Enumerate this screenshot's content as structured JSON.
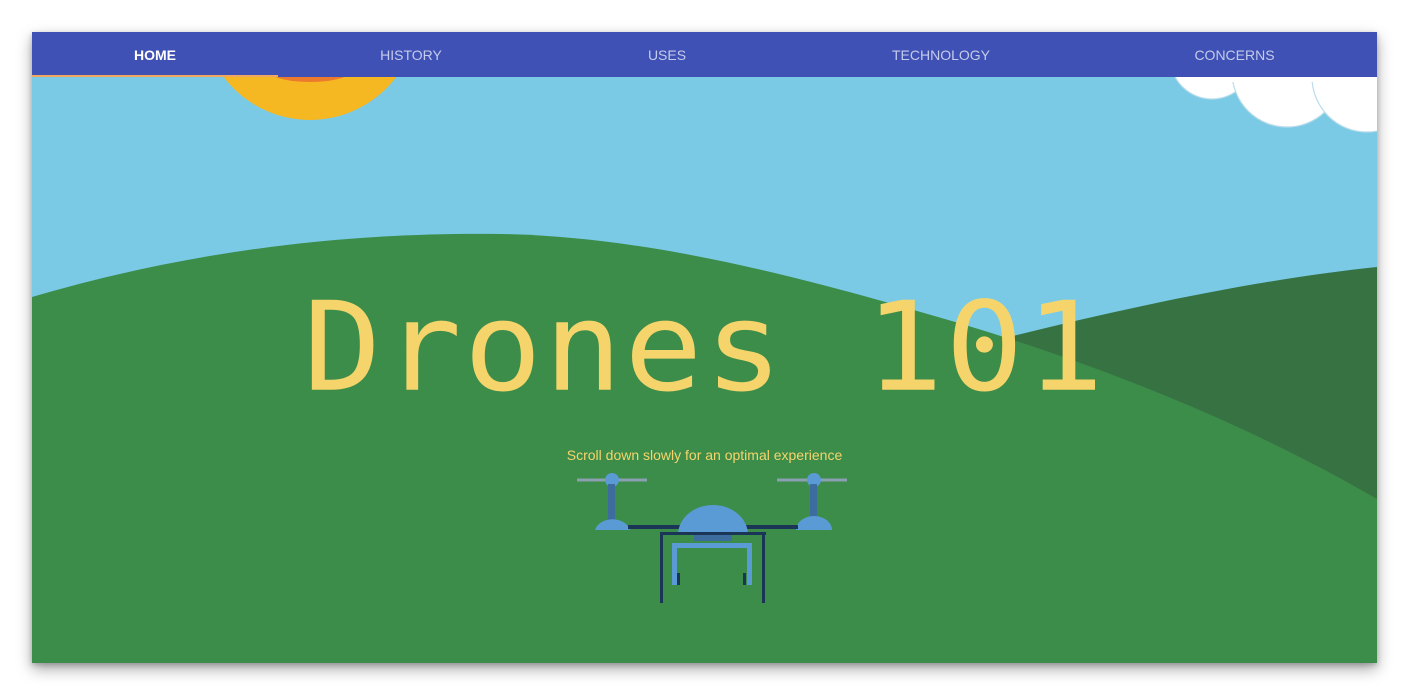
{
  "nav": {
    "tabs": [
      {
        "label": "HOME",
        "active": true
      },
      {
        "label": "HISTORY",
        "active": false
      },
      {
        "label": "USES",
        "active": false
      },
      {
        "label": "TECHNOLOGY",
        "active": false
      },
      {
        "label": "CONCERNS",
        "active": false
      }
    ]
  },
  "hero": {
    "title": "Drones 101",
    "subtitle": "Scroll down slowly for an optimal experience"
  },
  "colors": {
    "nav_bg": "#3F51B5",
    "sky": "#7ACAE6",
    "hill_front": "#3C8C4A",
    "hill_back": "#367242",
    "title": "#F5D56B",
    "sun": "#F5B722",
    "drone_light": "#5B9BD5",
    "drone_dark": "#1B3557"
  },
  "icons": [
    "sun-icon",
    "cloud-icon",
    "drone-icon"
  ]
}
